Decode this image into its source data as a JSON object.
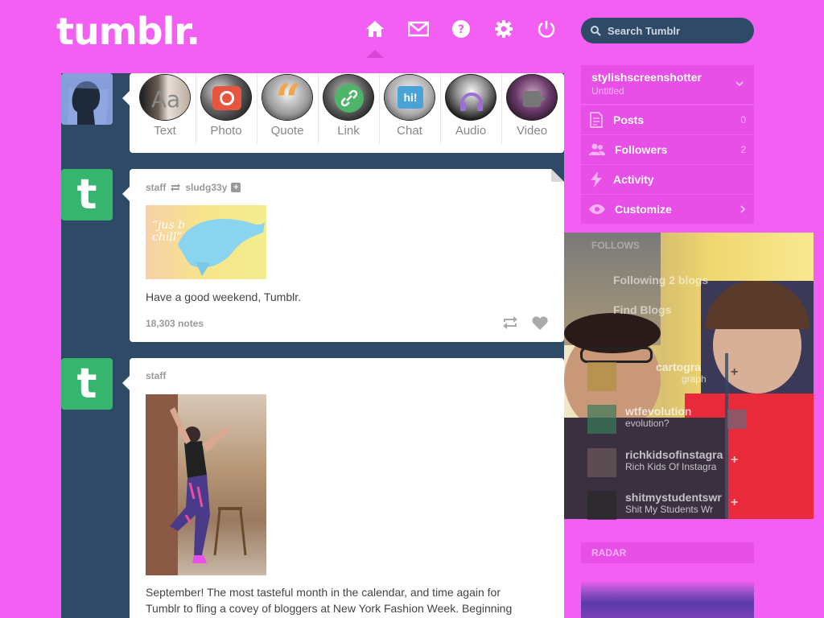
{
  "header": {
    "logo": "tumblr.",
    "search_placeholder": "Search Tumblr",
    "nav": [
      "home-icon",
      "mail-icon",
      "help-icon",
      "gear-icon",
      "power-icon"
    ]
  },
  "post_types": [
    {
      "label": "Text",
      "glyph": "Aa"
    },
    {
      "label": "Photo",
      "glyph": "camera"
    },
    {
      "label": "Quote",
      "glyph": "“"
    },
    {
      "label": "Link",
      "glyph": "link"
    },
    {
      "label": "Chat",
      "glyph": "hi!"
    },
    {
      "label": "Audio",
      "glyph": "headphones"
    },
    {
      "label": "Video",
      "glyph": "video"
    }
  ],
  "posts": [
    {
      "author": "staff",
      "reblogged_from": "sludg33y",
      "image_text": "“jus b chill”",
      "caption": "Have a good weekend, Tumblr.",
      "notes": "18,303 notes"
    },
    {
      "author": "staff",
      "caption_line1": "September! The most tasteful month in the calendar, and time again for",
      "caption_line2": "Tumblr to fling a covey of bloggers at New York Fashion Week. Beginning"
    }
  ],
  "sidebar": {
    "blog": {
      "name": "stylishscreenshotter",
      "subtitle": "Untitled"
    },
    "items": [
      {
        "label": "Posts",
        "count": "0",
        "icon": "posts-icon"
      },
      {
        "label": "Followers",
        "count": "2",
        "icon": "followers-icon"
      },
      {
        "label": "Activity",
        "count": "",
        "icon": "activity-icon"
      },
      {
        "label": "Customize",
        "count": "",
        "icon": "eye-icon"
      }
    ],
    "overlay_items": [
      {
        "label": "Following 2 blogs"
      },
      {
        "label": "Find Blogs"
      }
    ],
    "recommended": [
      {
        "name": "cartogra",
        "sub": "graph"
      },
      {
        "name": "wtfevolution",
        "sub": "evolution?"
      },
      {
        "name": "richkidsofinstagra",
        "sub": "Rich Kids Of Instagra"
      },
      {
        "name": "shitmystudentswr",
        "sub": "Shit My Students Wr"
      }
    ],
    "radar_label": "RADAR"
  },
  "colors": {
    "page": "#f45ff3",
    "dash": "#2f4a67",
    "sidebar": "#e84fe6",
    "tumblr_green": "#35b56d"
  }
}
